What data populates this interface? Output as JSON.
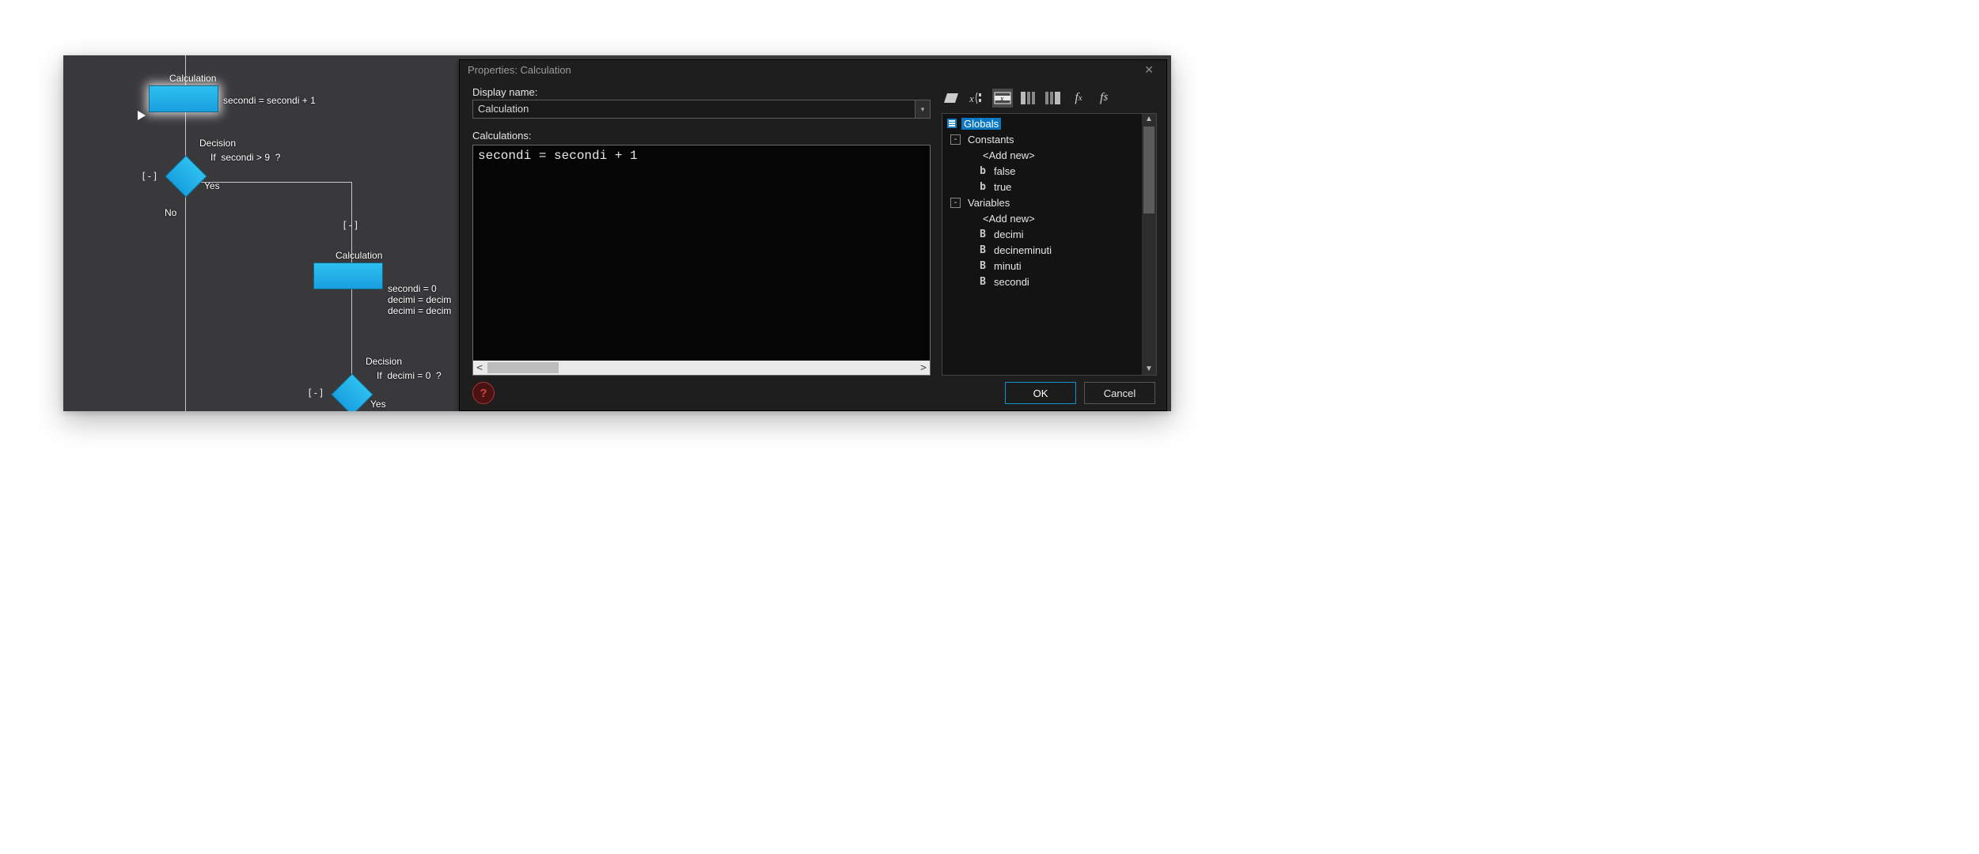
{
  "flowchart": {
    "node1": {
      "title": "Calculation",
      "expr": "secondi = secondi + 1"
    },
    "decision1": {
      "title": "Decision",
      "expr": "If  secondi > 9  ?",
      "yes": "Yes",
      "no": "No"
    },
    "node2": {
      "title": "Calculation",
      "lines": [
        "secondi = 0",
        "decimi = decim",
        "decimi = decim"
      ]
    },
    "decision2": {
      "title": "Decision",
      "expr": "If  decimi = 0  ?",
      "yes": "Yes"
    },
    "collapse": "[-]"
  },
  "dialog": {
    "title": "Properties: Calculation",
    "displayName_label": "Display name:",
    "displayName_value": "Calculation",
    "calculations_label": "Calculations:",
    "calculations_text": "secondi = secondi + 1",
    "ok": "OK",
    "cancel": "Cancel"
  },
  "tree": {
    "root": "Globals",
    "groups": [
      {
        "label": "Constants",
        "items": [
          "<Add new>",
          "false",
          "true"
        ]
      },
      {
        "label": "Variables",
        "items": [
          "<Add new>",
          "decimi",
          "decineminuti",
          "minuti",
          "secondi"
        ]
      }
    ]
  }
}
